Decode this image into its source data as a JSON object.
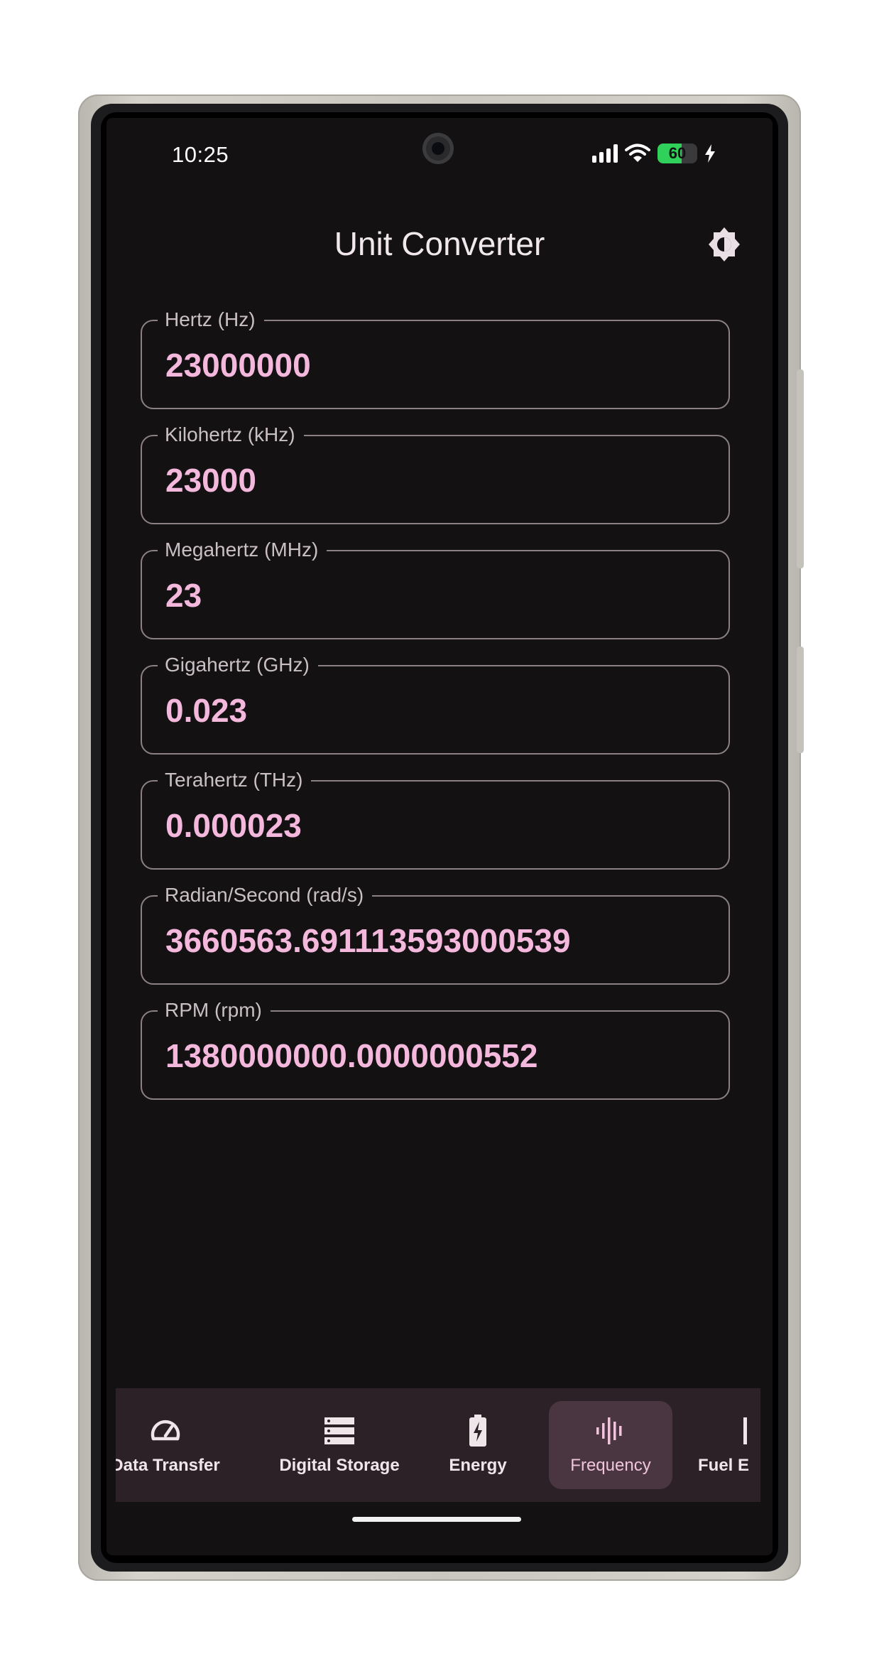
{
  "status_bar": {
    "time": "10:25",
    "battery_level": "60",
    "battery_fraction": 0.6,
    "icons": [
      "signal-icon",
      "wifi-icon",
      "battery-icon",
      "charging-bolt-icon"
    ]
  },
  "app_bar": {
    "title": "Unit Converter",
    "theme_toggle_icon": "brightness-icon"
  },
  "fields": [
    {
      "label": "Hertz (Hz)",
      "value": "23000000"
    },
    {
      "label": "Kilohertz (kHz)",
      "value": "23000"
    },
    {
      "label": "Megahertz (MHz)",
      "value": "23"
    },
    {
      "label": "Gigahertz (GHz)",
      "value": "0.023"
    },
    {
      "label": "Terahertz (THz)",
      "value": "0.000023"
    },
    {
      "label": "Radian/Second (rad/s)",
      "value": "3660563.691113593000539"
    },
    {
      "label": "RPM (rpm)",
      "value": "1380000000.0000000552"
    }
  ],
  "bottom_nav": {
    "items": [
      {
        "label": "Data Transfer",
        "icon": "speedometer-icon",
        "active": false
      },
      {
        "label": "Digital Storage",
        "icon": "storage-icon",
        "active": false
      },
      {
        "label": "Energy",
        "icon": "battery-bolt-icon",
        "active": false
      },
      {
        "label": "Frequency",
        "icon": "waveform-icon",
        "active": true
      },
      {
        "label": "Fuel E",
        "icon": "fuel-icon",
        "active": false
      }
    ]
  },
  "colors": {
    "background": "#141113",
    "accent_value": "#f4b8dc",
    "nav_background": "#2b2127",
    "nav_active": "#4a3641"
  }
}
